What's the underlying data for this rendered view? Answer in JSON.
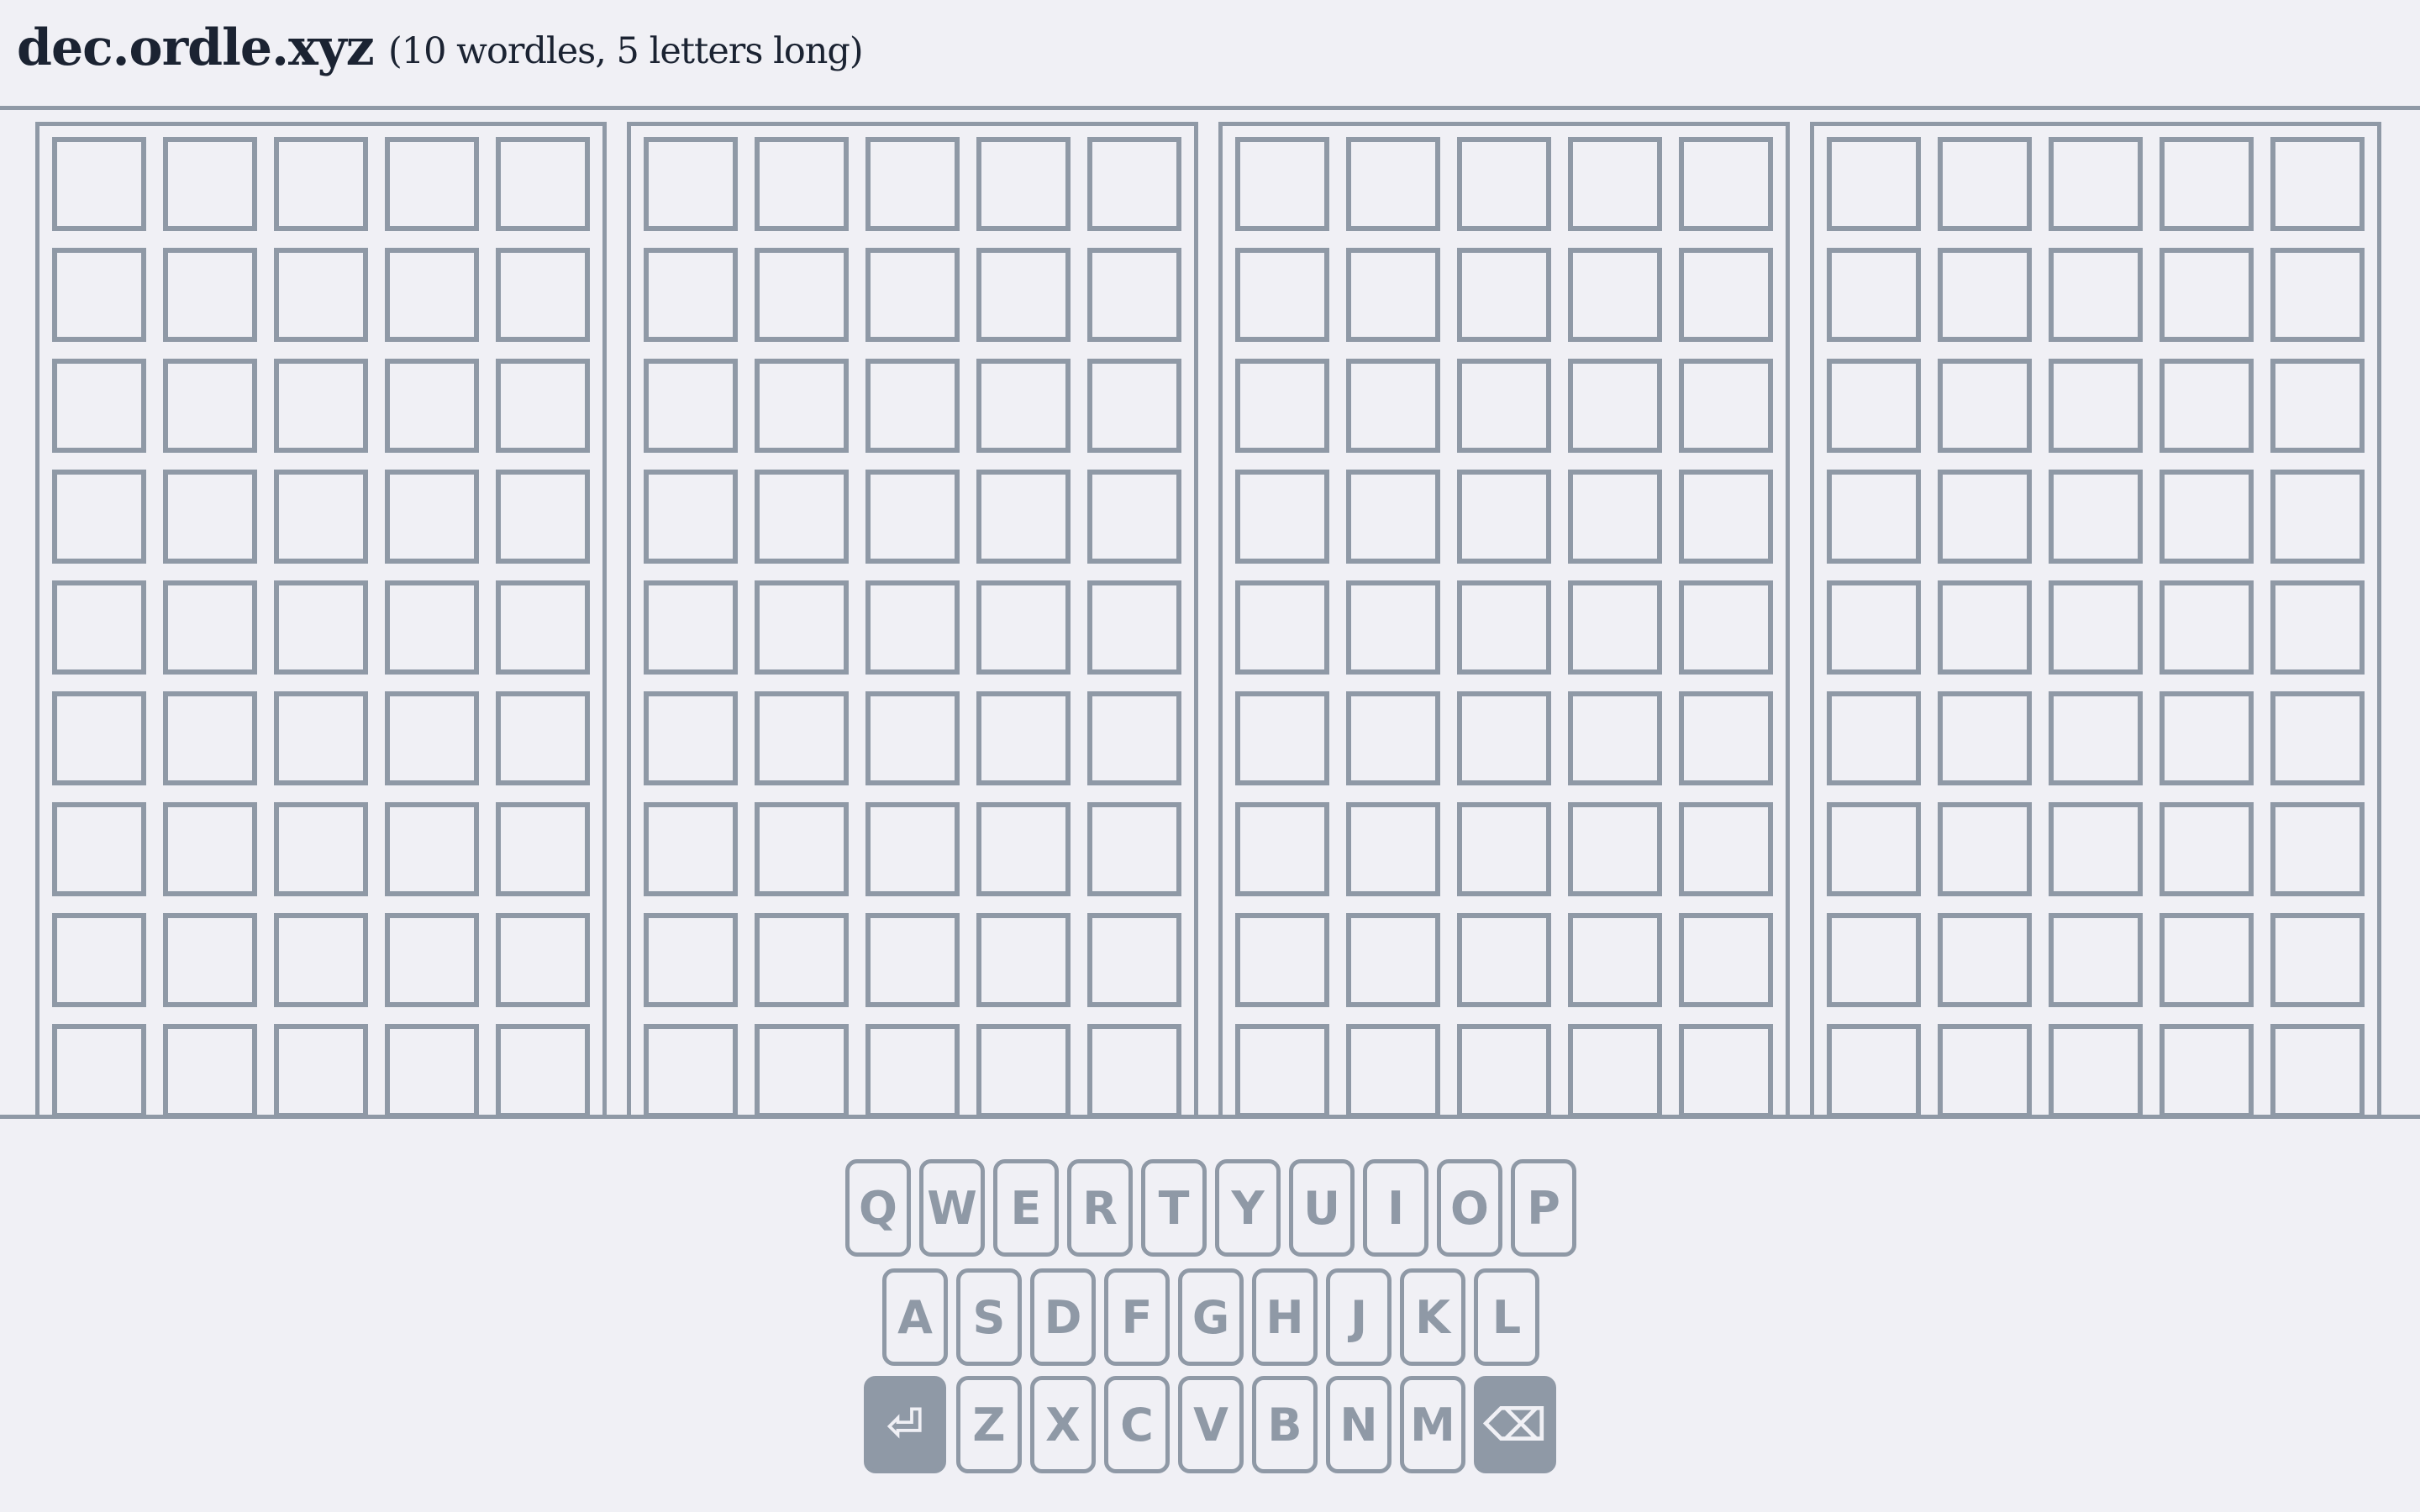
{
  "header": {
    "title": "dec.ordle.xyz",
    "subtitle": "(10 wordles, 5 letters long)"
  },
  "boards": {
    "visible_count": 4,
    "columns": 5,
    "visible_rows": 9,
    "colors": {
      "tile_border": "#8f99a6",
      "background": "#f0f0f5",
      "text": "#1b2332"
    }
  },
  "keyboard": {
    "rows": [
      [
        "Q",
        "W",
        "E",
        "R",
        "T",
        "Y",
        "U",
        "I",
        "O",
        "P"
      ],
      [
        "A",
        "S",
        "D",
        "F",
        "G",
        "H",
        "J",
        "K",
        "L"
      ],
      [
        "Z",
        "X",
        "C",
        "V",
        "B",
        "N",
        "M"
      ]
    ],
    "enter_label": "⏎",
    "enter_icon": "enter-icon",
    "backspace_label": "⌫",
    "backspace_icon": "backspace-icon"
  }
}
